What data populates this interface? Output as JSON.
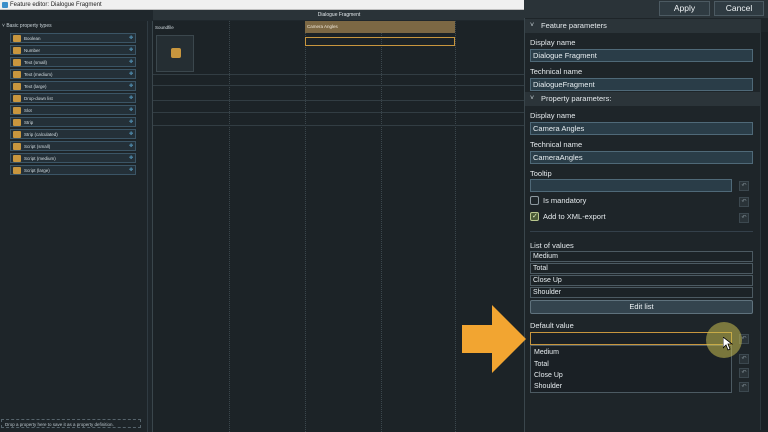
{
  "window": {
    "title": "Feature editor: Dialogue Fragment"
  },
  "left_panel": {
    "header": "Basic property types",
    "items": [
      {
        "label": "Boolean",
        "icon": "boolean-icon"
      },
      {
        "label": "Number",
        "icon": "number-icon"
      },
      {
        "label": "Text (small)",
        "icon": "text-icon"
      },
      {
        "label": "Text (medium)",
        "icon": "text-icon"
      },
      {
        "label": "Text (large)",
        "icon": "text-icon"
      },
      {
        "label": "Drop-down list",
        "icon": "dropdown-icon"
      },
      {
        "label": "Slot",
        "icon": "slot-icon"
      },
      {
        "label": "Strip",
        "icon": "strip-icon"
      },
      {
        "label": "Strip (calculated)",
        "icon": "strip-icon"
      },
      {
        "label": "Script (small)",
        "icon": "script-icon"
      },
      {
        "label": "Script (medium)",
        "icon": "script-icon"
      },
      {
        "label": "Script (large)",
        "icon": "script-icon"
      }
    ],
    "footer": "Drop a property here to save it as a property definition."
  },
  "canvas": {
    "header": "Dialogue Fragment",
    "columns": [
      {
        "label": "Soundfile"
      },
      {
        "label": "Camera Angles"
      }
    ]
  },
  "toolbar": {
    "apply_label": "Apply",
    "cancel_label": "Cancel"
  },
  "feature_params": {
    "section_label": "Feature parameters",
    "display_name_label": "Display name",
    "display_name_value": "Dialogue Fragment",
    "technical_name_label": "Technical name",
    "technical_name_value": "DialogueFragment"
  },
  "property_params": {
    "section_label": "Property parameters:",
    "display_name_label": "Display name",
    "display_name_value": "Camera Angles",
    "technical_name_label": "Technical name",
    "technical_name_value": "CameraAngles",
    "tooltip_label": "Tooltip",
    "tooltip_value": "",
    "is_mandatory_label": "Is mandatory",
    "is_mandatory_checked": false,
    "xml_export_label": "Add to XML-export",
    "xml_export_checked": true,
    "list_label": "List of values",
    "list_values": [
      "Medium",
      "Total",
      "Close Up",
      "Shoulder"
    ],
    "edit_list_label": "Edit list",
    "default_value_label": "Default value",
    "default_value": "",
    "dropdown_options": [
      "Medium",
      "Total",
      "Close Up",
      "Shoulder"
    ]
  },
  "colors": {
    "accent": "#c8963e",
    "arrow": "#f2a531",
    "panel": "#1e2529"
  }
}
